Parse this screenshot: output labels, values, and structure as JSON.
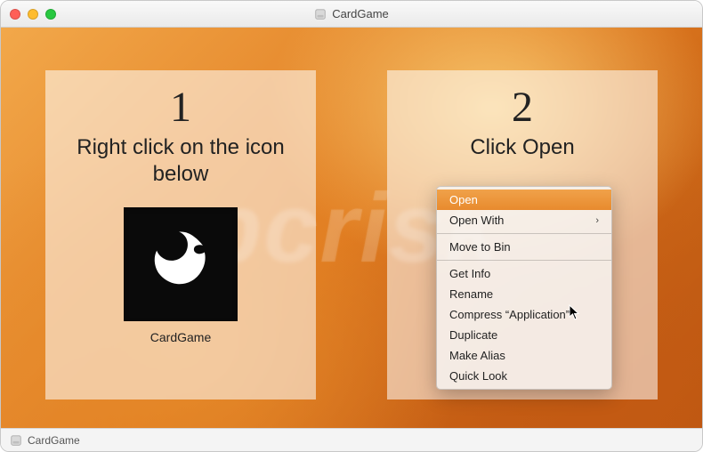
{
  "window": {
    "title": "CardGame"
  },
  "step1": {
    "number": "1",
    "text": "Right click on the icon below",
    "app_label": "CardGame"
  },
  "step2": {
    "number": "2",
    "text": "Click Open"
  },
  "menu": {
    "open": "Open",
    "open_with": "Open With",
    "move_to_bin": "Move to Bin",
    "get_info": "Get Info",
    "rename": "Rename",
    "compress": "Compress “Application”",
    "duplicate": "Duplicate",
    "make_alias": "Make Alias",
    "quick_look": "Quick Look"
  },
  "statusbar": {
    "label": "CardGame"
  },
  "watermark": "pcrisk"
}
